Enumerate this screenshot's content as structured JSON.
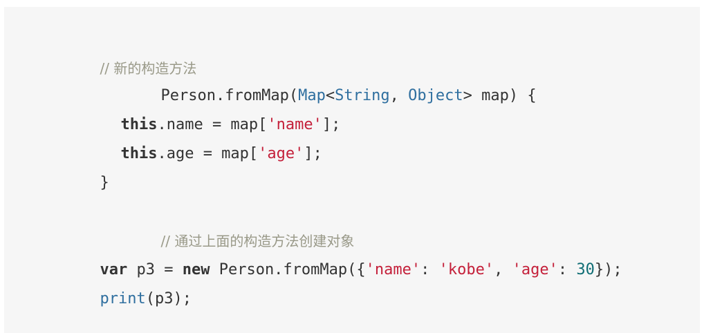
{
  "code": {
    "language": "dart",
    "lines": [
      {
        "comment": "// 新的构造方法"
      },
      {
        "prefix": "Person.fromMap(",
        "type1": "Map",
        "lt": "<",
        "type2": "String",
        "comma": ", ",
        "type3": "Object",
        "suffix": "> map) {"
      },
      {
        "keyword": "this",
        "middle": ".name = map[",
        "string": "'name'",
        "suffix": "];"
      },
      {
        "keyword": "this",
        "middle": ".age = map[",
        "string": "'age'",
        "suffix": "];"
      },
      {
        "text": "}"
      },
      {
        "comment": "// 通过上面的构造方法创建对象"
      },
      {
        "kw1": "var",
        "mid1": " p3 = ",
        "kw2": "new",
        "mid2": " Person.fromMap({",
        "str1": "'name'",
        "colon1": ": ",
        "str2": "'kobe'",
        "comma": ", ",
        "str3": "'age'",
        "colon2": ": ",
        "num": "30",
        "suffix": "});"
      },
      {
        "builtin": "print",
        "suffix": "(p3);"
      }
    ]
  }
}
